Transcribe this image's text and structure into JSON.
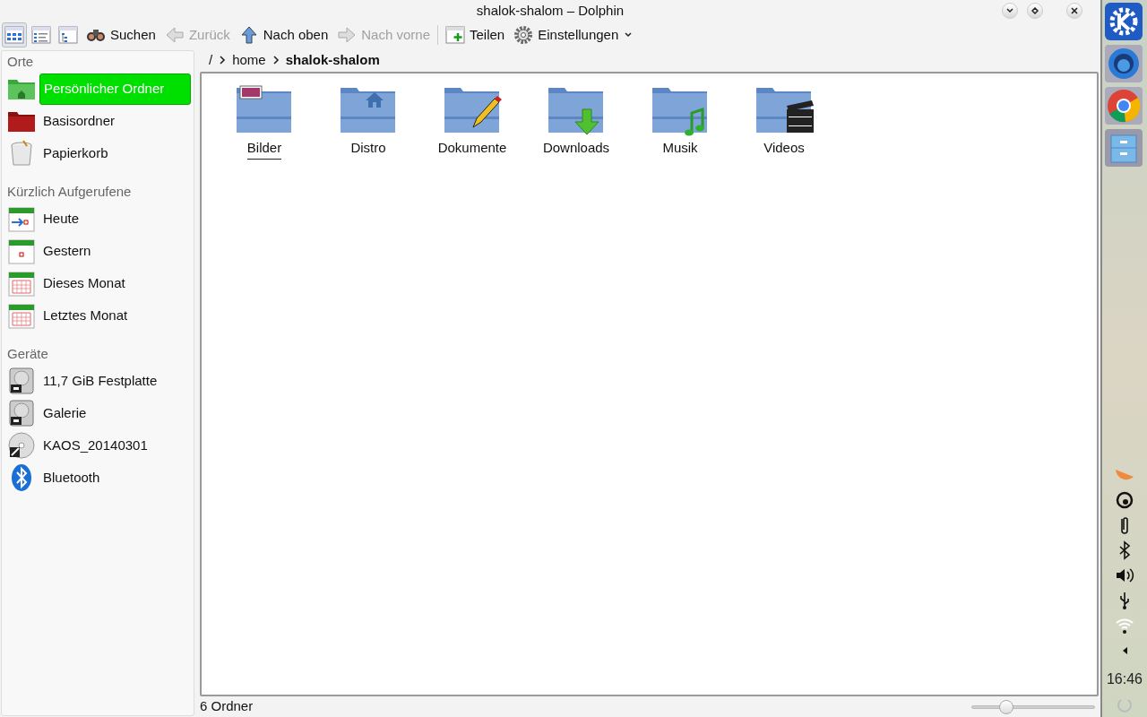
{
  "window": {
    "title": "shalok-shalom – Dolphin"
  },
  "toolbar": {
    "view_modes": [
      {
        "kind": "icons",
        "selected": true
      },
      {
        "kind": "compact",
        "selected": false
      },
      {
        "kind": "details",
        "selected": false
      }
    ],
    "buttons": [
      {
        "kind": "search",
        "label": "Suchen",
        "disabled": false
      },
      {
        "kind": "back",
        "label": "Zurück",
        "disabled": true
      },
      {
        "kind": "up",
        "label": "Nach oben",
        "disabled": false
      },
      {
        "kind": "forward",
        "label": "Nach vorne",
        "disabled": true
      },
      {
        "kind": "share",
        "label": "Teilen",
        "disabled": false
      },
      {
        "kind": "settings",
        "label": "Einstellungen",
        "disabled": false
      }
    ]
  },
  "sidebar": {
    "sections": [
      {
        "title": "Orte",
        "items": [
          {
            "kind": "home",
            "label": "Persönlicher Ordner",
            "selected": true
          },
          {
            "kind": "root",
            "label": "Basisordner",
            "selected": false
          },
          {
            "kind": "trash",
            "label": "Papierkorb",
            "selected": false
          }
        ]
      },
      {
        "title": "Kürzlich Aufgerufene",
        "items": [
          {
            "kind": "today",
            "label": "Heute",
            "selected": false
          },
          {
            "kind": "day",
            "label": "Gestern",
            "selected": false
          },
          {
            "kind": "month",
            "label": "Dieses Monat",
            "selected": false
          },
          {
            "kind": "month",
            "label": "Letztes Monat",
            "selected": false
          }
        ]
      },
      {
        "title": "Geräte",
        "items": [
          {
            "kind": "disk",
            "label": "11,7 GiB Festplatte",
            "selected": false
          },
          {
            "kind": "disk",
            "label": "Galerie",
            "selected": false
          },
          {
            "kind": "optical",
            "label": "KAOS_20140301",
            "selected": false
          },
          {
            "kind": "bluetooth",
            "label": "Bluetooth",
            "selected": false
          }
        ]
      }
    ]
  },
  "breadcrumb": [
    {
      "label": "/",
      "current": false
    },
    {
      "label": "home",
      "current": false
    },
    {
      "label": "shalok-shalom",
      "current": true
    }
  ],
  "files": [
    {
      "name": "Bilder",
      "kind": "pictures",
      "hovered": true
    },
    {
      "name": "Distro",
      "kind": "home",
      "hovered": false
    },
    {
      "name": "Dokumente",
      "kind": "pencil",
      "hovered": false
    },
    {
      "name": "Downloads",
      "kind": "download",
      "hovered": false
    },
    {
      "name": "Musik",
      "kind": "music",
      "hovered": false
    },
    {
      "name": "Videos",
      "kind": "clapper",
      "hovered": false
    }
  ],
  "status_bar": {
    "text": "6 Ordner",
    "zoom": {
      "level": 0.25
    }
  },
  "panel": {
    "launchers": [
      {
        "kind": "kde"
      },
      {
        "kind": "globe"
      },
      {
        "kind": "browser"
      },
      {
        "kind": "cabinet"
      }
    ],
    "tray": [
      {
        "kind": "orange"
      },
      {
        "kind": "circle"
      },
      {
        "kind": "clip"
      },
      {
        "kind": "bluetooth"
      },
      {
        "kind": "volume"
      },
      {
        "kind": "usb"
      },
      {
        "kind": "wifi"
      },
      {
        "kind": "arrow"
      }
    ],
    "clock": "16:46"
  }
}
